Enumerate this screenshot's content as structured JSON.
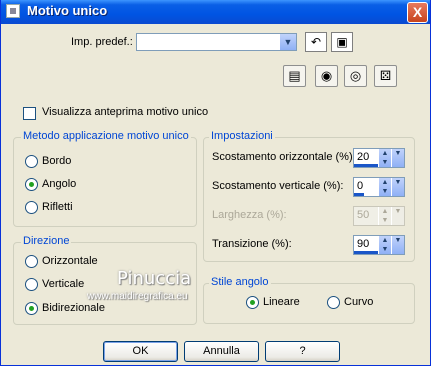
{
  "window": {
    "title": "Motivo unico",
    "close_glyph": "X"
  },
  "preset": {
    "label": "Imp. predef.:",
    "value": ""
  },
  "toolbar_icons": [
    "reset-icon",
    "save-icon",
    "window-icon",
    "eye-hand-icon",
    "eye-icon",
    "dice-icon"
  ],
  "preview": {
    "label": "Visualizza anteprima motivo unico",
    "checked": false
  },
  "metodo": {
    "title": "Metodo applicazione motivo unico",
    "options": [
      "Bordo",
      "Angolo",
      "Rifletti"
    ],
    "selected": "Angolo"
  },
  "direzione": {
    "title": "Direzione",
    "options": [
      "Orizzontale",
      "Verticale",
      "Bidirezionale"
    ],
    "selected": "Bidirezionale"
  },
  "impostazioni": {
    "title": "Impostazioni",
    "fields": [
      {
        "label": "Scostamento orizzontale (%):",
        "value": "20",
        "enabled": true,
        "fill": 0.6
      },
      {
        "label": "Scostamento verticale (%):",
        "value": "0",
        "enabled": true,
        "fill": 0.02
      },
      {
        "label": "Larghezza (%):",
        "value": "50",
        "enabled": false,
        "fill": 0
      },
      {
        "label": "Transizione (%):",
        "value": "90",
        "enabled": true,
        "fill": 0.95
      }
    ]
  },
  "stile": {
    "title": "Stile angolo",
    "options": [
      "Lineare",
      "Curvo"
    ],
    "selected": "Lineare"
  },
  "watermark": {
    "line1": "Pinuccia",
    "line2": "www.maidiregrafica.eu"
  },
  "buttons": {
    "ok": "OK",
    "cancel": "Annulla",
    "help": "?"
  }
}
